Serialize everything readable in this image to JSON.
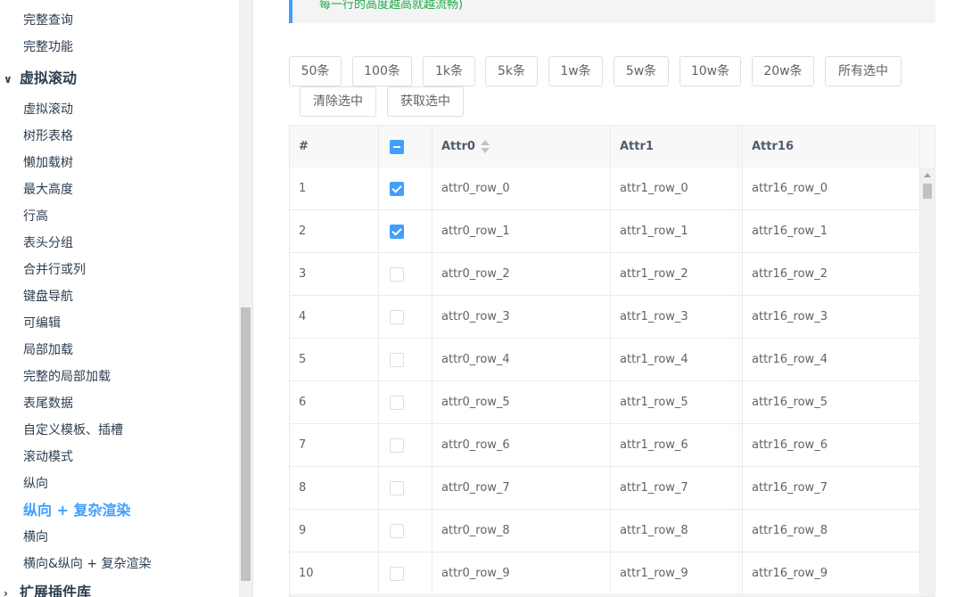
{
  "sidebar": {
    "items_top": [
      "完整查询",
      "完整功能"
    ],
    "group_virtual": "虚拟滚动",
    "items": [
      "虚拟滚动",
      "树形表格",
      "懒加载树",
      "最大高度",
      "行高",
      "表头分组",
      "合并行或列",
      "键盘导航",
      "可编辑",
      "局部加载",
      "完整的局部加载",
      "表尾数据",
      "自定义模板、插槽",
      "滚动模式",
      "纵向",
      "纵向 + 复杂渲染",
      "横向",
      "横向&纵向 + 复杂渲染"
    ],
    "active_item": "纵向 + 复杂渲染",
    "group_next": "扩展插件库"
  },
  "tip": {
    "text": "每一行的高度越高就越流畅)"
  },
  "buttons": [
    "50条",
    "100条",
    "1k条",
    "5k条",
    "1w条",
    "5w条",
    "10w条",
    "20w条",
    "所有选中",
    "清除选中",
    "获取选中"
  ],
  "table": {
    "headers": {
      "index": "#",
      "attr0": "Attr0",
      "attr1": "Attr1",
      "attr16": "Attr16"
    },
    "header_checkbox": "indeterminate",
    "rows": [
      {
        "index": "1",
        "checked": true,
        "attr0": "attr0_row_0",
        "attr1": "attr1_row_0",
        "attr16": "attr16_row_0"
      },
      {
        "index": "2",
        "checked": true,
        "attr0": "attr0_row_1",
        "attr1": "attr1_row_1",
        "attr16": "attr16_row_1"
      },
      {
        "index": "3",
        "checked": false,
        "attr0": "attr0_row_2",
        "attr1": "attr1_row_2",
        "attr16": "attr16_row_2"
      },
      {
        "index": "4",
        "checked": false,
        "attr0": "attr0_row_3",
        "attr1": "attr1_row_3",
        "attr16": "attr16_row_3"
      },
      {
        "index": "5",
        "checked": false,
        "attr0": "attr0_row_4",
        "attr1": "attr1_row_4",
        "attr16": "attr16_row_4"
      },
      {
        "index": "6",
        "checked": false,
        "attr0": "attr0_row_5",
        "attr1": "attr1_row_5",
        "attr16": "attr16_row_5"
      },
      {
        "index": "7",
        "checked": false,
        "attr0": "attr0_row_6",
        "attr1": "attr1_row_6",
        "attr16": "attr16_row_6"
      },
      {
        "index": "8",
        "checked": false,
        "attr0": "attr0_row_7",
        "attr1": "attr1_row_7",
        "attr16": "attr16_row_7"
      },
      {
        "index": "9",
        "checked": false,
        "attr0": "attr0_row_8",
        "attr1": "attr1_row_8",
        "attr16": "attr16_row_8"
      },
      {
        "index": "10",
        "checked": false,
        "attr0": "attr0_row_9",
        "attr1": "attr1_row_9",
        "attr16": "attr16_row_9"
      }
    ]
  },
  "colors": {
    "accent": "#409eff",
    "tip_text": "#21a94c"
  }
}
